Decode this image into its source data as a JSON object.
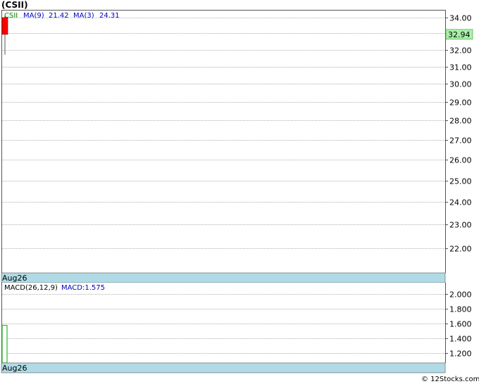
{
  "title": "(CSII)",
  "watermark": "© 12Stocks.com",
  "colors": {
    "grid": "#b0b0b0",
    "frame": "#555555",
    "date_band": "#b0dbe6",
    "candle_down": "#ff0000",
    "macd_bar": "#00aa00",
    "price_tag_bg": "#a8f0a8",
    "legend_ticker": "#008000",
    "legend_ma": "#0000cc",
    "macd_label": "#0000cc"
  },
  "chart_data": [
    {
      "type": "candlestick",
      "ticker": "CSII",
      "legend": {
        "ticker": "CSII",
        "ma9_label": "MA(9)",
        "ma9_value": "21.42",
        "ma3_label": "MA(3)",
        "ma3_value": "24.31"
      },
      "ylim": [
        21.0,
        34.5
      ],
      "y_ticks": [
        "34.00",
        "33.00",
        "32.00",
        "31.00",
        "30.00",
        "29.00",
        "28.00",
        "27.00",
        "26.00",
        "25.00",
        "24.00",
        "23.00",
        "22.00"
      ],
      "y_tick_values": [
        34,
        33,
        32,
        31,
        30,
        29,
        28,
        27,
        26,
        25,
        24,
        23,
        22
      ],
      "date_label": "Aug26",
      "last_price": "32.94",
      "last_price_value": 32.94,
      "candles": [
        {
          "open": 34.0,
          "high": 34.1,
          "low": 31.7,
          "close": 32.94
        }
      ],
      "grid": true
    },
    {
      "type": "bar",
      "indicator": "MACD",
      "label": "MACD(26,12,9)",
      "macd_label": "MACD:1.575",
      "ylim": [
        1.07,
        2.15
      ],
      "y_ticks": [
        "2.000",
        "1.800",
        "1.600",
        "1.400",
        "1.200"
      ],
      "y_tick_values": [
        2.0,
        1.8,
        1.6,
        1.4,
        1.2
      ],
      "values": [
        1.575
      ],
      "date_label": "Aug26",
      "grid": true
    }
  ]
}
